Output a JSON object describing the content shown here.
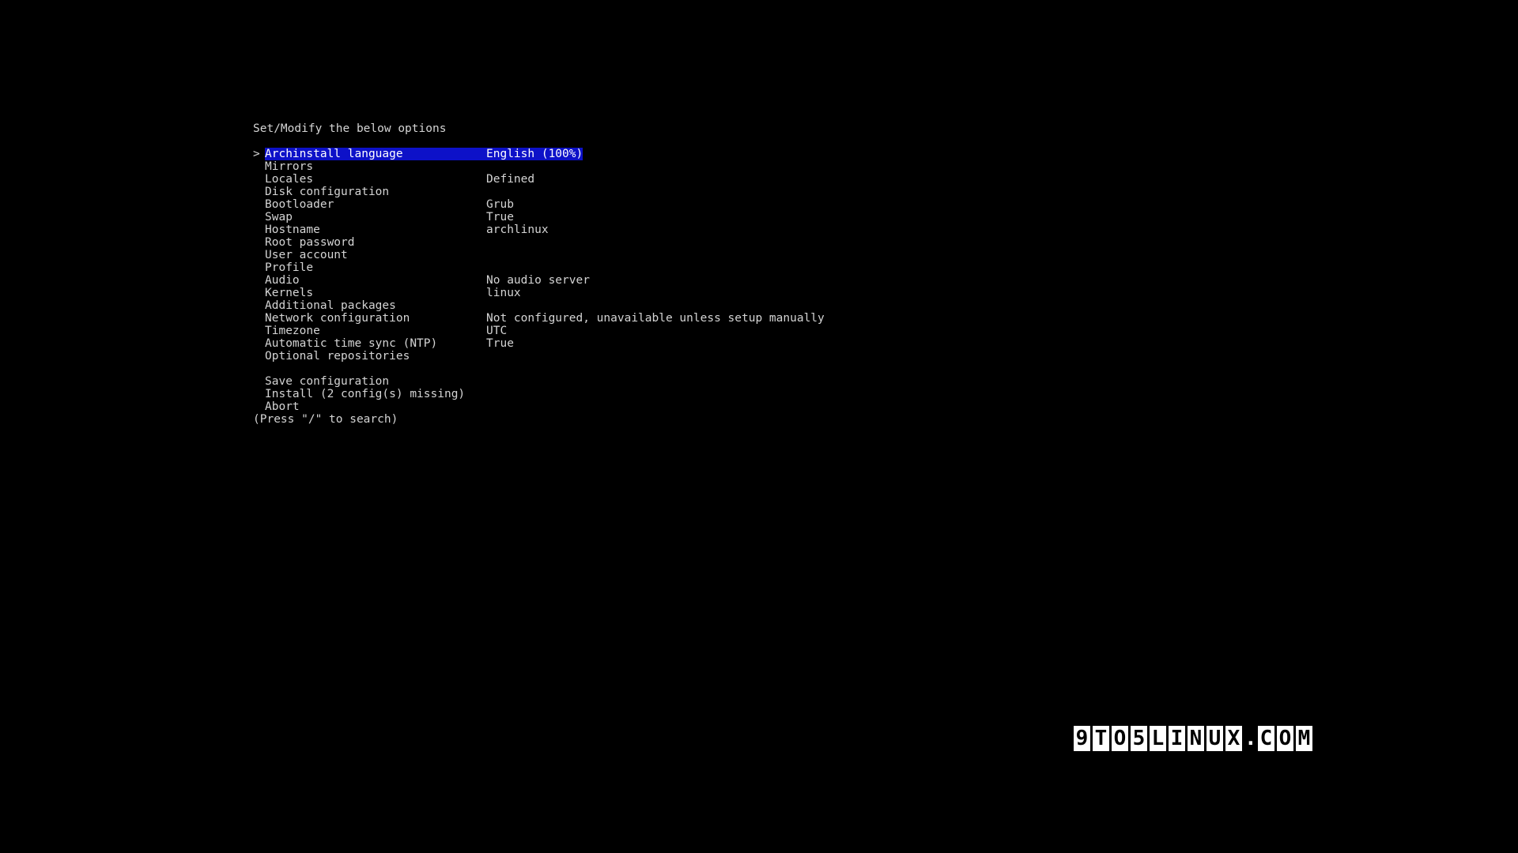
{
  "header": "Set/Modify the below options",
  "selected_indicator": ">",
  "menu": [
    {
      "label": "Archinstall language",
      "value": "English (100%)",
      "selected": true
    },
    {
      "label": "Mirrors",
      "value": ""
    },
    {
      "label": "Locales",
      "value": "Defined"
    },
    {
      "label": "Disk configuration",
      "value": ""
    },
    {
      "label": "Bootloader",
      "value": "Grub"
    },
    {
      "label": "Swap",
      "value": "True"
    },
    {
      "label": "Hostname",
      "value": "archlinux"
    },
    {
      "label": "Root password",
      "value": ""
    },
    {
      "label": "User account",
      "value": ""
    },
    {
      "label": "Profile",
      "value": ""
    },
    {
      "label": "Audio",
      "value": "No audio server"
    },
    {
      "label": "Kernels",
      "value": "linux"
    },
    {
      "label": "Additional packages",
      "value": ""
    },
    {
      "label": "Network configuration",
      "value": "Not configured, unavailable unless setup manually"
    },
    {
      "label": "Timezone",
      "value": "UTC"
    },
    {
      "label": "Automatic time sync (NTP)",
      "value": "True"
    },
    {
      "label": "Optional repositories",
      "value": ""
    }
  ],
  "actions": [
    {
      "label": "Save configuration"
    },
    {
      "label": "Install (2 config(s) missing)"
    },
    {
      "label": "Abort"
    }
  ],
  "footer": "(Press \"/\" to search)",
  "watermark": [
    "9",
    "T",
    "O",
    "5",
    "L",
    "I",
    "N",
    "U",
    "X",
    ".",
    "C",
    "O",
    "M"
  ],
  "colors": {
    "background": "#000000",
    "text": "#d4d4d4",
    "highlight": "#0d11c8"
  }
}
